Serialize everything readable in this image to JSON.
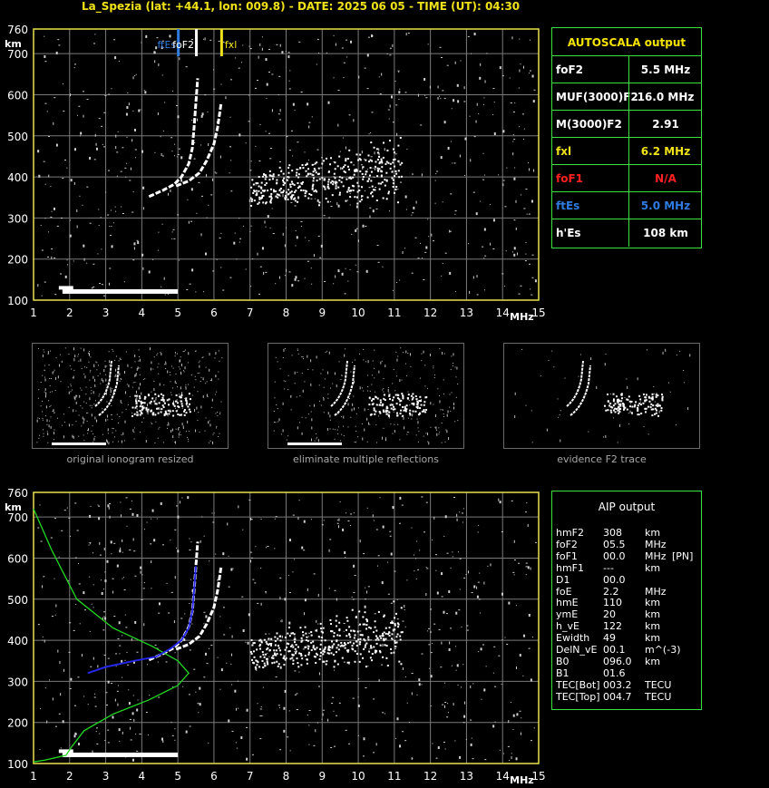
{
  "header": {
    "title": "La_Spezia (lat: +44.1, lon: 009.8) - DATE: 2025 06 05 - TIME (UT): 04:30"
  },
  "chart_data": [
    {
      "type": "scatter",
      "name": "ionogram-top",
      "xlabel": "MHz",
      "ylabel": "km",
      "xlim": [
        1,
        15
      ],
      "ylim": [
        100,
        760
      ],
      "x_ticks": [
        "1",
        "2",
        "3",
        "4",
        "5",
        "6",
        "7",
        "8",
        "9",
        "10",
        "11",
        "12",
        "13",
        "14",
        "15"
      ],
      "y_ticks": [
        "100",
        "200",
        "300",
        "400",
        "500",
        "600",
        "700",
        "760"
      ],
      "markers": [
        {
          "label": "ftEs",
          "x": 5.0,
          "color": "#2f7be0"
        },
        {
          "label": "foF2",
          "x": 5.5,
          "color": "#ffffff"
        },
        {
          "label": "fxl",
          "x": 6.2,
          "color": "#f0e21a"
        }
      ],
      "traces": {
        "es_layer": {
          "x_start": 1.8,
          "x_end": 5.0,
          "h": 120
        },
        "o_trace": [
          [
            4.2,
            352
          ],
          [
            4.6,
            368
          ],
          [
            4.9,
            382
          ],
          [
            5.1,
            400
          ],
          [
            5.3,
            432
          ],
          [
            5.4,
            470
          ],
          [
            5.45,
            520
          ],
          [
            5.5,
            580
          ],
          [
            5.55,
            640
          ]
        ],
        "x_trace": [
          [
            4.95,
            378
          ],
          [
            5.3,
            390
          ],
          [
            5.6,
            410
          ],
          [
            5.8,
            440
          ],
          [
            6.0,
            480
          ],
          [
            6.1,
            520
          ],
          [
            6.2,
            580
          ]
        ]
      }
    },
    {
      "type": "line",
      "name": "ionogram-bottom",
      "xlabel": "MHz",
      "ylabel": "km",
      "xlim": [
        1,
        15
      ],
      "ylim": [
        100,
        760
      ],
      "x_ticks": [
        "1",
        "2",
        "3",
        "4",
        "5",
        "6",
        "7",
        "8",
        "9",
        "10",
        "11",
        "12",
        "13",
        "14",
        "15"
      ],
      "y_ticks": [
        "100",
        "200",
        "300",
        "400",
        "500",
        "600",
        "700",
        "760"
      ],
      "series": [
        {
          "color": "#24d924",
          "points": [
            [
              1.0,
              720
            ],
            [
              1.5,
              620
            ],
            [
              2.2,
              500
            ],
            [
              3.2,
              430
            ],
            [
              4.3,
              385
            ],
            [
              5.0,
              350
            ],
            [
              5.3,
              320
            ],
            [
              5.0,
              290
            ],
            [
              4.2,
              255
            ],
            [
              3.2,
              220
            ],
            [
              2.4,
              180
            ],
            [
              2.05,
              140
            ],
            [
              1.9,
              120
            ],
            [
              1.3,
              108
            ],
            [
              1.0,
              104
            ]
          ]
        },
        {
          "color": "#2626e6",
          "points": [
            [
              2.5,
              320
            ],
            [
              3.0,
              335
            ],
            [
              3.8,
              350
            ],
            [
              4.4,
              360
            ],
            [
              4.8,
              380
            ],
            [
              5.1,
              400
            ],
            [
              5.3,
              430
            ],
            [
              5.4,
              470
            ],
            [
              5.45,
              520
            ],
            [
              5.5,
              580
            ]
          ]
        }
      ],
      "traces": {
        "es_layer": {
          "x_start": 1.8,
          "x_end": 5.0,
          "h": 120
        },
        "o_trace": [
          [
            4.2,
            352
          ],
          [
            4.6,
            368
          ],
          [
            4.9,
            382
          ],
          [
            5.1,
            400
          ],
          [
            5.3,
            432
          ],
          [
            5.4,
            470
          ],
          [
            5.45,
            520
          ],
          [
            5.5,
            580
          ],
          [
            5.55,
            640
          ]
        ],
        "x_trace": [
          [
            4.95,
            378
          ],
          [
            5.3,
            390
          ],
          [
            5.6,
            410
          ],
          [
            5.8,
            440
          ],
          [
            6.0,
            480
          ],
          [
            6.1,
            520
          ],
          [
            6.2,
            580
          ]
        ]
      }
    }
  ],
  "autoscala": {
    "title": "AUTOSCALA output",
    "rows": [
      {
        "label": "foF2",
        "value": "5.5 MHz",
        "lc": "#ffffff",
        "vc": "#ffffff"
      },
      {
        "label": "MUF(3000)F2",
        "value": "16.0 MHz",
        "lc": "#ffffff",
        "vc": "#ffffff"
      },
      {
        "label": "M(3000)F2",
        "value": "2.91",
        "lc": "#ffffff",
        "vc": "#ffffff"
      },
      {
        "label": "fxl",
        "value": "6.2 MHz",
        "lc": "#f0e21a",
        "vc": "#f0e21a"
      },
      {
        "label": "foF1",
        "value": "N/A",
        "lc": "#ff2020",
        "vc": "#ff2020"
      },
      {
        "label": "ftEs",
        "value": "5.0 MHz",
        "lc": "#2f7be0",
        "vc": "#2f7be0"
      },
      {
        "label": "h'Es",
        "value": "108     km",
        "lc": "#ffffff",
        "vc": "#ffffff"
      }
    ]
  },
  "aip": {
    "title": "AIP output",
    "rows": [
      [
        "hmF2",
        "308",
        "km",
        ""
      ],
      [
        "foF2",
        "05.5",
        "MHz",
        ""
      ],
      [
        "foF1",
        "00.0",
        "MHz",
        "[PN]"
      ],
      [
        "hmF1",
        "---",
        "km",
        ""
      ],
      [
        "D1",
        "00.0",
        "",
        ""
      ],
      [
        "foE",
        "2.2",
        "MHz",
        ""
      ],
      [
        "hmE",
        "110",
        "km",
        ""
      ],
      [
        "ymE",
        "20",
        "km",
        ""
      ],
      [
        "h_vE",
        "122",
        "km",
        ""
      ],
      [
        "Ewidth",
        "49",
        "km",
        ""
      ],
      [
        "DelN_vE",
        "00.1",
        "m^(-3)",
        ""
      ],
      [
        "B0",
        "096.0",
        "km",
        ""
      ],
      [
        "B1",
        "01.6",
        "",
        ""
      ],
      [
        "TEC[Bot]",
        "003.2",
        "TECU",
        ""
      ],
      [
        "TEC[Top]",
        "004.7",
        "TECU",
        ""
      ]
    ]
  },
  "thumbnails": [
    {
      "caption": "original ionogram resized"
    },
    {
      "caption": "eliminate multiple reflections"
    },
    {
      "caption": "evidence F2 trace"
    }
  ],
  "colors": {
    "grid": "#7a7a7a",
    "frame": "#e8e24a",
    "panel_border": "#3de13d"
  }
}
